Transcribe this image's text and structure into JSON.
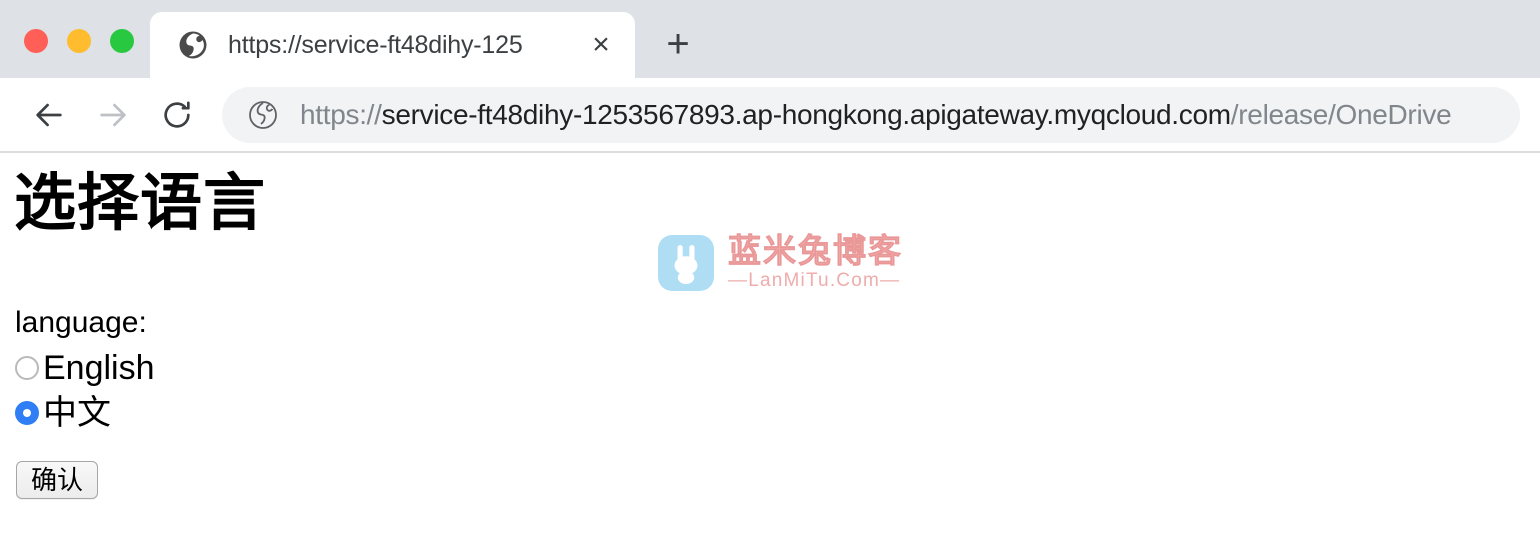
{
  "browser": {
    "traffic_lights": [
      {
        "name": "close",
        "color": "#ff5f56"
      },
      {
        "name": "minimize",
        "color": "#febc2e"
      },
      {
        "name": "maximize",
        "color": "#28c840"
      }
    ],
    "tab": {
      "title": "https://service-ft48dihy-125",
      "favicon": "globe-icon",
      "close_label": "×"
    },
    "new_tab_label": "+",
    "nav": {
      "back": "back-arrow-icon",
      "forward": "forward-arrow-icon",
      "reload": "reload-icon"
    },
    "omnibox": {
      "favicon": "globe-icon",
      "url_full": "https://service-ft48dihy-1253567893.ap-hongkong.apigateway.myqcloud.com/release/OneDrive",
      "url_scheme": "https://",
      "url_host": "service-ft48dihy-1253567893.ap-hongkong.apigateway.myqcloud.com",
      "url_path": "/release/OneDrive"
    }
  },
  "page": {
    "title": "选择语言",
    "language_label": "language:",
    "options": [
      {
        "value": "en",
        "label": "English",
        "selected": false
      },
      {
        "value": "zh",
        "label": "中文",
        "selected": true
      }
    ],
    "confirm_button": "确认",
    "accent_color": "#2f7ef5"
  },
  "watermark": {
    "icon": "rabbit-icon",
    "icon_color": "#a9dcf4",
    "brand_cn": "蓝米兔博客",
    "brand_en": "—LanMiTu.Com—",
    "text_color": "#f0a3a3"
  }
}
